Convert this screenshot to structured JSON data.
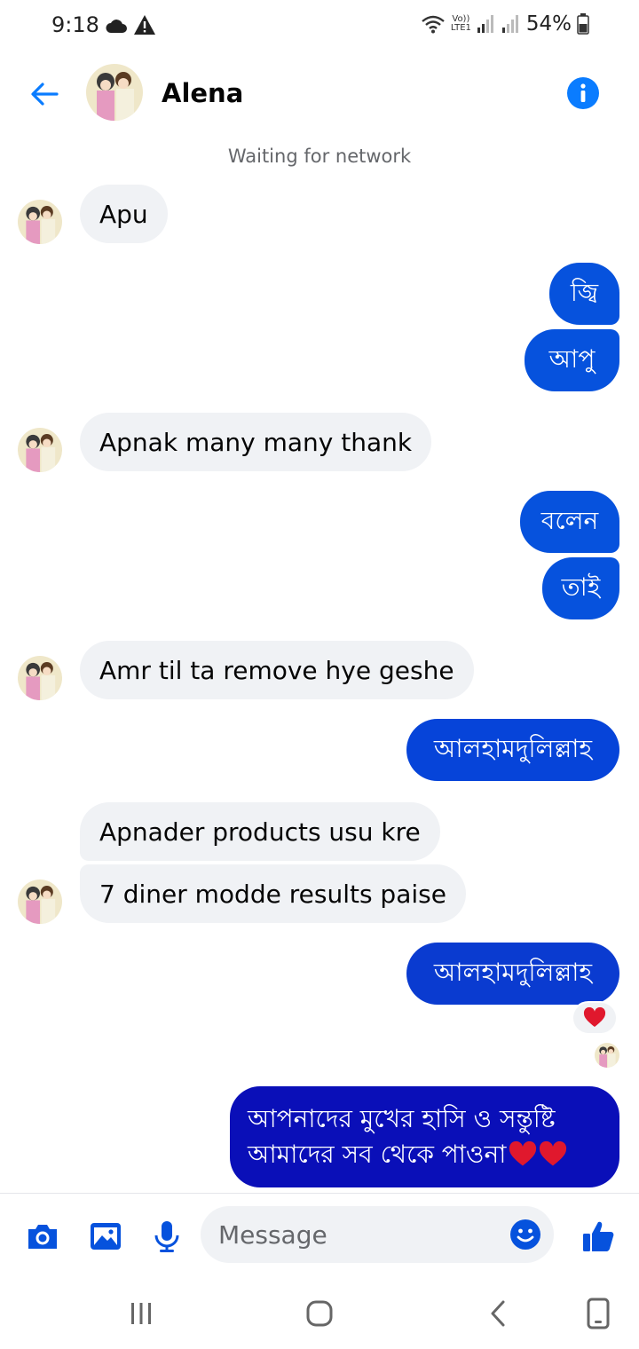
{
  "status_bar": {
    "time": "9:18",
    "volte_top": "Vo))",
    "volte_bottom": "LTE1",
    "battery": "54%",
    "icons": [
      "cloud-icon",
      "warning-icon",
      "wifi-icon",
      "signal-icon",
      "battery-icon"
    ]
  },
  "header": {
    "contact_name": "Alena",
    "back_icon": "arrow-left-icon",
    "info_icon": "info-icon"
  },
  "network_status": "Waiting for network",
  "messages": [
    {
      "dir": "in",
      "text": "Apu"
    },
    {
      "dir": "out",
      "text": "জ্বি"
    },
    {
      "dir": "out",
      "text": "আপু"
    },
    {
      "dir": "in",
      "text": "Apnak many many thank"
    },
    {
      "dir": "out",
      "text": "বলেন"
    },
    {
      "dir": "out",
      "text": "তাই"
    },
    {
      "dir": "in",
      "text": "Amr til ta remove hye geshe"
    },
    {
      "dir": "out",
      "text": "আলহামদুলিল্লাহ"
    },
    {
      "dir": "in",
      "text": "Apnader products usu kre"
    },
    {
      "dir": "in",
      "text": "7 diner modde results paise"
    },
    {
      "dir": "out",
      "text": "আলহামদুলিল্লাহ",
      "reaction": "heart"
    },
    {
      "dir": "out",
      "text_line1": "আপনাদের মুখের হাসি ও সন্তুষ্টি",
      "text_line2": "আমাদের সব থেকে পাওনা"
    }
  ],
  "composer": {
    "placeholder": "Message",
    "icons": [
      "camera-icon",
      "gallery-icon",
      "microphone-icon",
      "emoji-icon",
      "thumbs-up-icon"
    ]
  },
  "colors": {
    "accent": "#0a7cff",
    "bubble_light": "#0652dd",
    "bubble_dark": "#0a0fb8",
    "incoming": "#f0f2f5"
  }
}
